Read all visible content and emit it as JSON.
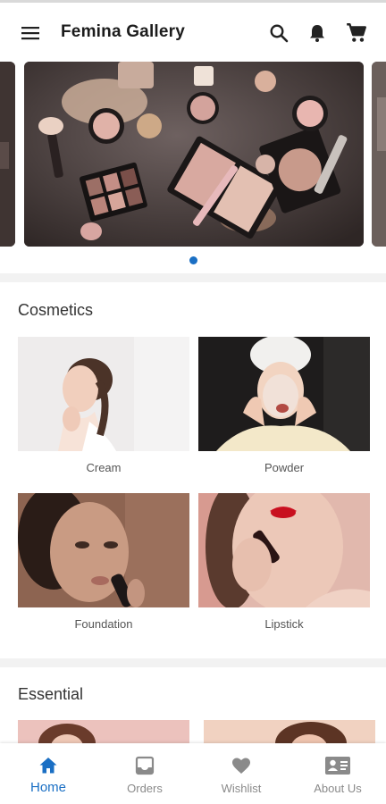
{
  "app": {
    "title": "Femina Gallery"
  },
  "header": {
    "menu_icon": "menu-icon",
    "actions": [
      "search-icon",
      "notifications-icon",
      "cart-icon"
    ]
  },
  "carousel": {
    "slides": 3,
    "active_index": 1,
    "dot_color": "#1a6fc4"
  },
  "sections": {
    "cosmetics": {
      "title": "Cosmetics",
      "items": [
        {
          "label": "Cream"
        },
        {
          "label": "Powder"
        },
        {
          "label": "Foundation"
        },
        {
          "label": "Lipstick"
        }
      ]
    },
    "essential": {
      "title": "Essential"
    }
  },
  "bottom_nav": {
    "items": [
      {
        "label": "Home",
        "icon": "home-icon",
        "active": true
      },
      {
        "label": "Orders",
        "icon": "inbox-icon",
        "active": false
      },
      {
        "label": "Wishlist",
        "icon": "heart-icon",
        "active": false
      },
      {
        "label": "About Us",
        "icon": "contact-card-icon",
        "active": false
      }
    ]
  },
  "colors": {
    "accent": "#1a6fc4",
    "text": "#222222",
    "muted": "#8a8a8a"
  }
}
